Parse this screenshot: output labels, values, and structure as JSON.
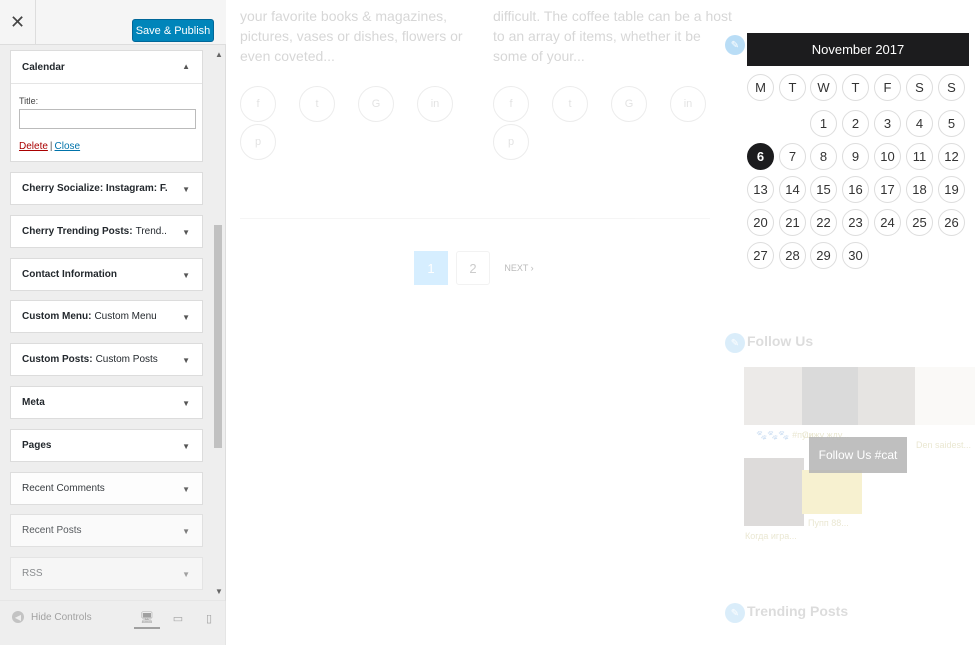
{
  "customizer": {
    "close_glyph": "✕",
    "publish_label": "Save & Publish",
    "calendar_widget": {
      "title": "Calendar",
      "field_label": "Title:",
      "field_value": "",
      "delete_label": "Delete",
      "separator": "|",
      "close_label": "Close"
    },
    "widgets": [
      {
        "title": "Cherry Socialize: Instagram: F...",
        "subtitle": ""
      },
      {
        "title": "Cherry Trending Posts:",
        "subtitle": "Trend..."
      },
      {
        "title": "Contact Information",
        "subtitle": ""
      },
      {
        "title": "Custom Menu:",
        "subtitle": "Custom Menu"
      },
      {
        "title": "Custom Posts:",
        "subtitle": "Custom Posts"
      },
      {
        "title": "Meta",
        "subtitle": ""
      },
      {
        "title": "Pages",
        "subtitle": ""
      },
      {
        "title": "Recent Comments",
        "subtitle": ""
      },
      {
        "title": "Recent Posts",
        "subtitle": ""
      },
      {
        "title": "RSS",
        "subtitle": ""
      }
    ],
    "footer": {
      "hide_controls": "Hide Controls"
    }
  },
  "preview": {
    "excerpts": [
      [
        "your favorite books & magazines,",
        "pictures, vases or dishes, flowers or",
        "even coveted..."
      ],
      [
        "difficult. The coffee table can be a host",
        "to an array of items, whether it be",
        "some of your..."
      ]
    ],
    "social_icons": [
      "f",
      "t",
      "G",
      "in",
      "p"
    ],
    "pagination": {
      "current": "1",
      "next_page": "2",
      "next_label": "NEXT ›"
    },
    "calendar": {
      "caption": "November 2017",
      "weekdays": [
        "M",
        "T",
        "W",
        "T",
        "F",
        "S",
        "S"
      ],
      "days": [
        "1",
        "2",
        "3",
        "4",
        "5",
        "6",
        "7",
        "8",
        "9",
        "10",
        "11",
        "12",
        "13",
        "14",
        "15",
        "16",
        "17",
        "18",
        "19",
        "20",
        "21",
        "22",
        "23",
        "24",
        "25",
        "26",
        "27",
        "28",
        "29",
        "30"
      ],
      "today": "6"
    },
    "follow_title": "Follow Us",
    "follow_button": "Follow Us #cat",
    "insta_captions": [
      "🐾🐾🐾 #пуш...",
      "Сижу жду...",
      "Den saidest...",
      "Когда игра...",
      "Пупп 88..."
    ],
    "trending_title": "Trending Posts",
    "colors": {
      "accent": "#0085ba",
      "calendar_dark": "#1c1c1e"
    }
  }
}
